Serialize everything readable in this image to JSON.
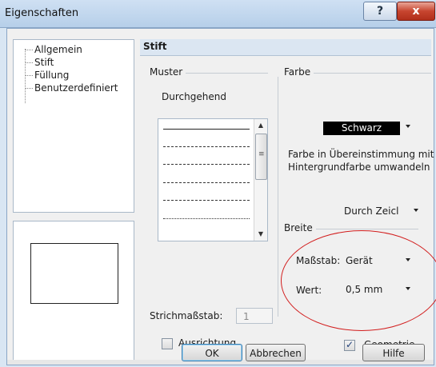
{
  "window": {
    "title": "Eigenschaften",
    "help_button": "?",
    "close_button": "x"
  },
  "tree": {
    "items": [
      "Allgemein",
      "Stift",
      "Füllung",
      "Benutzerdefiniert"
    ]
  },
  "panel": {
    "title": "Stift"
  },
  "muster": {
    "group_label": "Muster",
    "current_pattern": "Durchgehend",
    "patterns": [
      "solid",
      "dash-dot-dot",
      "long-dash-dot",
      "dash-dot",
      "dashed",
      "dash-dot-dot-fine"
    ],
    "scroll_thumb_glyph": "≡"
  },
  "farbe": {
    "group_label": "Farbe",
    "color_value": "Schwarz",
    "color_hex": "#000000",
    "convert_text_line1": "Farbe in Übereinstimmung mit",
    "convert_text_line2": "Hintergrundfarbe umwandeln",
    "durch_value": "Durch Zeicl"
  },
  "breite": {
    "group_label": "Breite",
    "massstab_label": "Maßstab:",
    "massstab_value": "Gerät",
    "wert_label": "Wert:",
    "wert_value": "0,5 mm"
  },
  "strichmassstab": {
    "label": "Strichmaßstab:",
    "value": "1"
  },
  "ausrichtung": {
    "label": "Ausrichtung",
    "checked": false
  },
  "geometrie": {
    "label": "Geometrie",
    "checked": true
  },
  "buttons": {
    "ok": "OK",
    "abbrechen": "Abbrechen",
    "hilfe": "Hilfe"
  },
  "highlight_color": "#d21d1d"
}
